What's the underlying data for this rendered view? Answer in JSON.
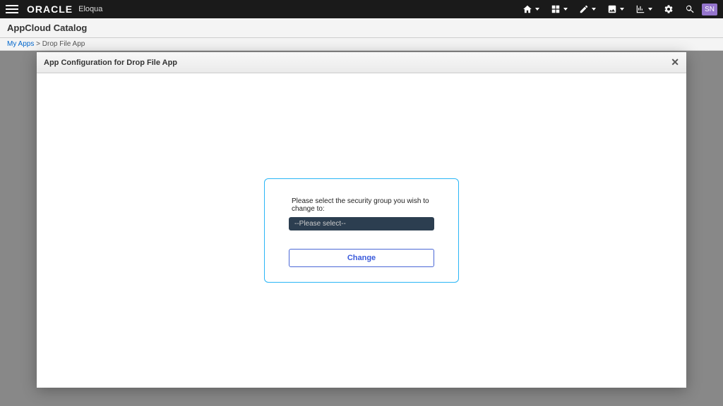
{
  "topnav": {
    "brand": "ORACLE",
    "product": "Eloqua",
    "user_initials": "SN"
  },
  "page": {
    "title": "AppCloud Catalog"
  },
  "breadcrumb": {
    "link1": "My Apps",
    "sep": ">",
    "current": "Drop File App"
  },
  "modal": {
    "title": "App Configuration for Drop File App",
    "config": {
      "label": "Please select the security group you wish to change to:",
      "select_placeholder": "--Please select--",
      "button_label": "Change"
    }
  }
}
